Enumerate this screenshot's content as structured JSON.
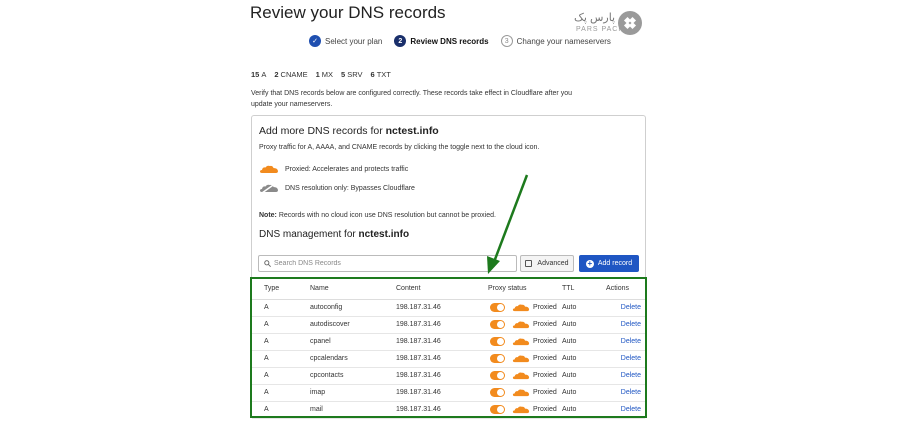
{
  "page": {
    "title": "Review your DNS records"
  },
  "logo": {
    "text_fa": "پارس پک",
    "text_en": "PARS PACK"
  },
  "stepper": {
    "steps": [
      {
        "num": "✓",
        "label": "Select your plan",
        "state": "done"
      },
      {
        "num": "2",
        "label": "Review DNS records",
        "state": "active"
      },
      {
        "num": "3",
        "label": "Change your nameservers",
        "state": "todo"
      }
    ]
  },
  "counts": [
    {
      "n": "15",
      "type": "A"
    },
    {
      "n": "2",
      "type": "CNAME"
    },
    {
      "n": "1",
      "type": "MX"
    },
    {
      "n": "5",
      "type": "SRV"
    },
    {
      "n": "6",
      "type": "TXT"
    }
  ],
  "intro": "Verify that DNS records below are configured correctly. These records take effect in Cloudflare after you update your nameservers.",
  "card": {
    "title_prefix": "Add more DNS records for",
    "domain": "nctest.info",
    "desc": "Proxy traffic for A, AAAA, and CNAME records by clicking the toggle next to the cloud icon.",
    "legend_proxied": "Proxied: Accelerates and protects traffic",
    "legend_dns": "DNS resolution only: Bypasses Cloudflare",
    "note_label": "Note:",
    "note_text": "Records with no cloud icon use DNS resolution but cannot be proxied.",
    "mgmt_prefix": "DNS management for",
    "mgmt_domain": "nctest.info"
  },
  "search": {
    "placeholder": "Search DNS Records"
  },
  "buttons": {
    "advanced": "Advanced",
    "add_record": "Add record"
  },
  "table": {
    "headers": {
      "type": "Type",
      "name": "Name",
      "content": "Content",
      "proxy": "Proxy status",
      "ttl": "TTL",
      "actions": "Actions"
    },
    "rows": [
      {
        "type": "A",
        "name": "autoconfig",
        "content": "198.187.31.46",
        "proxy": "Proxied",
        "ttl": "Auto",
        "action": "Delete"
      },
      {
        "type": "A",
        "name": "autodiscover",
        "content": "198.187.31.46",
        "proxy": "Proxied",
        "ttl": "Auto",
        "action": "Delete"
      },
      {
        "type": "A",
        "name": "cpanel",
        "content": "198.187.31.46",
        "proxy": "Proxied",
        "ttl": "Auto",
        "action": "Delete"
      },
      {
        "type": "A",
        "name": "cpcalendars",
        "content": "198.187.31.46",
        "proxy": "Proxied",
        "ttl": "Auto",
        "action": "Delete"
      },
      {
        "type": "A",
        "name": "cpcontacts",
        "content": "198.187.31.46",
        "proxy": "Proxied",
        "ttl": "Auto",
        "action": "Delete"
      },
      {
        "type": "A",
        "name": "imap",
        "content": "198.187.31.46",
        "proxy": "Proxied",
        "ttl": "Auto",
        "action": "Delete"
      },
      {
        "type": "A",
        "name": "mail",
        "content": "198.187.31.46",
        "proxy": "Proxied",
        "ttl": "Auto",
        "action": "Delete"
      }
    ]
  },
  "colors": {
    "accent": "#1f56c3",
    "proxied_orange": "#f28b1e",
    "highlight_green": "#1d7a1d"
  }
}
